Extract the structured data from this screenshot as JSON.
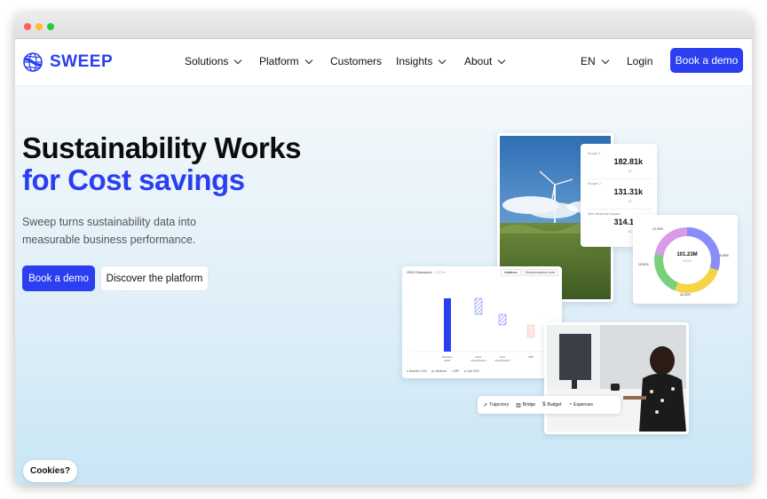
{
  "brand": {
    "name": "SWEEP",
    "accent": "#2b3ff0"
  },
  "nav": {
    "items": [
      {
        "label": "Solutions",
        "dropdown": true
      },
      {
        "label": "Platform",
        "dropdown": true
      },
      {
        "label": "Customers",
        "dropdown": false
      },
      {
        "label": "Insights",
        "dropdown": true
      },
      {
        "label": "About",
        "dropdown": true
      }
    ],
    "language": "EN",
    "login": "Login",
    "cta": "Book a demo"
  },
  "hero": {
    "title_line1": "Sustainability Works",
    "title_line2": "for Cost savings",
    "subtitle": "Sweep turns sustainability data into measurable business performance.",
    "primary_cta": "Book a demo",
    "secondary_cta": "Discover the platform"
  },
  "cookies": "Cookies?",
  "stats_card": {
    "items": [
      {
        "label": "Scope 1",
        "value": "182.81k",
        "unit": "tC"
      },
      {
        "label": "Scope 2",
        "value": "131.31k",
        "unit": "tC"
      },
      {
        "label": "Non-financial impact",
        "value": "314.12k",
        "unit": "tC"
      }
    ]
  },
  "donut_card": {
    "center_value": "101.23M",
    "center_sub": "tCO2e",
    "segments": [
      {
        "label": "15.89%",
        "color": "#8a8df7",
        "fraction": 0.3
      },
      {
        "label": "26.42%",
        "color": "#f5d547",
        "fraction": 0.26
      },
      {
        "label": "19.52%",
        "color": "#7bd17b",
        "fraction": 0.22
      },
      {
        "label": "12.43%",
        "color": "#d99ae8",
        "fraction": 0.22
      }
    ]
  },
  "ghg_card": {
    "title": "GHG Emissions",
    "title_sub": "tCO2e",
    "tabs": [
      "Initiatives",
      "Decarbonization lever"
    ],
    "categories": [
      "Baseline 2020",
      "Fleet electrification",
      "New electrification",
      "SBP",
      "Goal 2030"
    ],
    "legend": [
      "Baseline 2020",
      "Initiatives",
      "SBP",
      "Goal 2030"
    ]
  },
  "pills": [
    {
      "icon": "trajectory-icon",
      "glyph": "↗",
      "label": "Trajectory"
    },
    {
      "icon": "bridge-icon",
      "glyph": "▥",
      "label": "Bridge"
    },
    {
      "icon": "budget-icon",
      "glyph": "$",
      "label": "Budget"
    },
    {
      "icon": "expenses-icon",
      "glyph": "◔",
      "label": "Expenses"
    }
  ]
}
